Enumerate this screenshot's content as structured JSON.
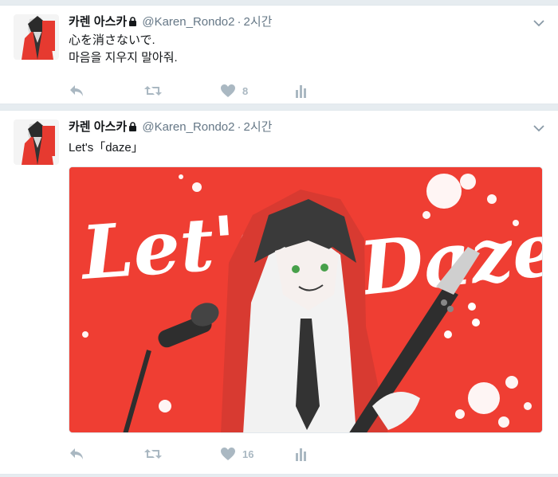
{
  "tweets": [
    {
      "fullname": "카렌 아스카",
      "handle": "@Karen_Rondo2",
      "dot": "·",
      "time": "2시간",
      "lines": [
        "心を消さないで.",
        "마음을 지우지 말아줘."
      ],
      "likes": "8"
    },
    {
      "fullname": "카렌 아스카",
      "handle": "@Karen_Rondo2",
      "dot": "·",
      "time": "2시간",
      "lines": [
        "Let's「daze」"
      ],
      "likes": "16",
      "media": {
        "title_left": "Let's",
        "title_right": "Daze"
      }
    }
  ],
  "colors": {
    "accent_red": "#ef3e33",
    "icon_gray": "#aab8c2",
    "meta_gray": "#657786"
  },
  "icons": [
    "lock-icon",
    "caret-down-icon",
    "reply-icon",
    "retweet-icon",
    "heart-icon",
    "analytics-icon"
  ]
}
